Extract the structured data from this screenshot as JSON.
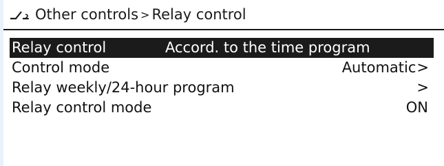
{
  "header": {
    "icon": "relay-switch-icon",
    "breadcrumb_parent": "Other controls",
    "breadcrumb_separator": ">",
    "breadcrumb_current": "Relay control"
  },
  "menu": {
    "items": [
      {
        "label": "Relay control",
        "value": "Accord. to the time program",
        "chevron": "",
        "selected": true
      },
      {
        "label": "Control mode",
        "value": "Automatic",
        "chevron": ">",
        "selected": false
      },
      {
        "label": "Relay weekly/24-hour program",
        "value": "",
        "chevron": ">",
        "selected": false
      },
      {
        "label": "Relay control mode",
        "value": "ON",
        "chevron": "",
        "selected": false
      }
    ]
  },
  "colors": {
    "highlight_bg": "#1b1b1b",
    "highlight_text": "#ffffff",
    "text": "#111111",
    "side_panel": "#e8f2fc"
  }
}
